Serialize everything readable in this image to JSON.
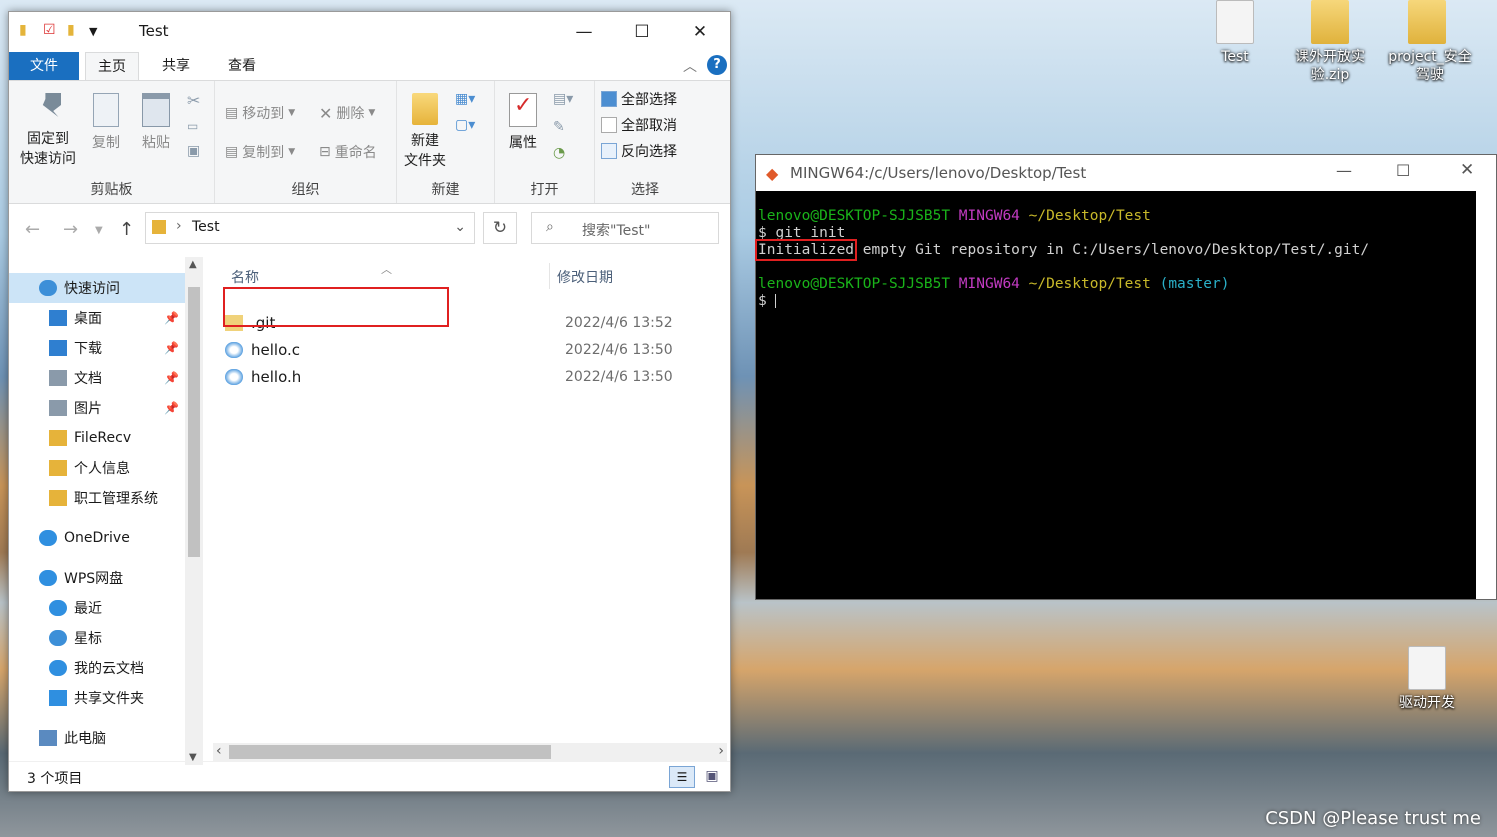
{
  "desktop": {
    "icons": [
      {
        "label": "Test",
        "type": "folder"
      },
      {
        "label": "课外开放实验.zip",
        "type": "zip"
      },
      {
        "label": "project_安全驾驶",
        "type": "zip"
      },
      {
        "label": "驱动开发",
        "type": "doc"
      }
    ],
    "watermark": "CSDN @Please trust me"
  },
  "explorer": {
    "title": "Test",
    "window_controls": {
      "minimize": "—",
      "maximize": "☐",
      "close": "✕"
    },
    "tabs": [
      "文件",
      "主页",
      "共享",
      "查看"
    ],
    "active_tab": "主页",
    "ribbon": {
      "clipboard": {
        "group": "剪贴板",
        "pin_label": "固定到\n快速访问",
        "copy": "复制",
        "paste": "粘贴"
      },
      "organize": {
        "group": "组织",
        "move_to": "移动到",
        "copy_to": "复制到",
        "delete": "删除",
        "rename": "重命名"
      },
      "new": {
        "group": "新建",
        "new_folder": "新建\n文件夹"
      },
      "open": {
        "group": "打开",
        "properties": "属性"
      },
      "select": {
        "group": "选择",
        "select_all": "全部选择",
        "select_none": "全部取消",
        "invert": "反向选择"
      }
    },
    "address": {
      "path": "Test"
    },
    "search": {
      "placeholder": "搜索\"Test\""
    },
    "sidebar": [
      {
        "label": "快速访问",
        "icon": "star-icon",
        "pinned": false,
        "selected": true
      },
      {
        "label": "桌面",
        "icon": "desktop-icon",
        "pinned": true
      },
      {
        "label": "下载",
        "icon": "download-icon",
        "pinned": true
      },
      {
        "label": "文档",
        "icon": "document-icon",
        "pinned": true
      },
      {
        "label": "图片",
        "icon": "picture-icon",
        "pinned": true
      },
      {
        "label": "FileRecv",
        "icon": "folder-icon"
      },
      {
        "label": "个人信息",
        "icon": "folder-icon"
      },
      {
        "label": "职工管理系统",
        "icon": "folder-icon"
      },
      {
        "label": "OneDrive",
        "icon": "cloud-icon"
      },
      {
        "label": "WPS网盘",
        "icon": "cloud-icon"
      },
      {
        "label": "最近",
        "icon": "clock-icon"
      },
      {
        "label": "星标",
        "icon": "star-icon"
      },
      {
        "label": "我的云文档",
        "icon": "cloud-icon"
      },
      {
        "label": "共享文件夹",
        "icon": "share-icon"
      },
      {
        "label": "此电脑",
        "icon": "computer-icon"
      }
    ],
    "columns": {
      "name": "名称",
      "modified": "修改日期"
    },
    "files": [
      {
        "name": ".git",
        "modified": "2022/4/6 13:52",
        "type": "folder"
      },
      {
        "name": "hello.c",
        "modified": "2022/4/6 13:50",
        "type": "file"
      },
      {
        "name": "hello.h",
        "modified": "2022/4/6 13:50",
        "type": "file"
      }
    ],
    "status": "3 个项目"
  },
  "terminal": {
    "title": "MINGW64:/c/Users/lenovo/Desktop/Test",
    "lines": {
      "prompt1_user": "lenovo@DESKTOP-SJJSB5T",
      "prompt1_env": "MINGW64",
      "prompt1_path": "~/Desktop/Test",
      "cmd1": "$ git init",
      "out1_highlight": "Initialized",
      "out1_rest": " empty Git repository in C:/Users/lenovo/Desktop/Test/.git/",
      "prompt2_user": "lenovo@DESKTOP-SJJSB5T",
      "prompt2_env": "MINGW64",
      "prompt2_path": "~/Desktop/Test",
      "prompt2_branch": "(master)",
      "cmd2": "$ "
    }
  }
}
